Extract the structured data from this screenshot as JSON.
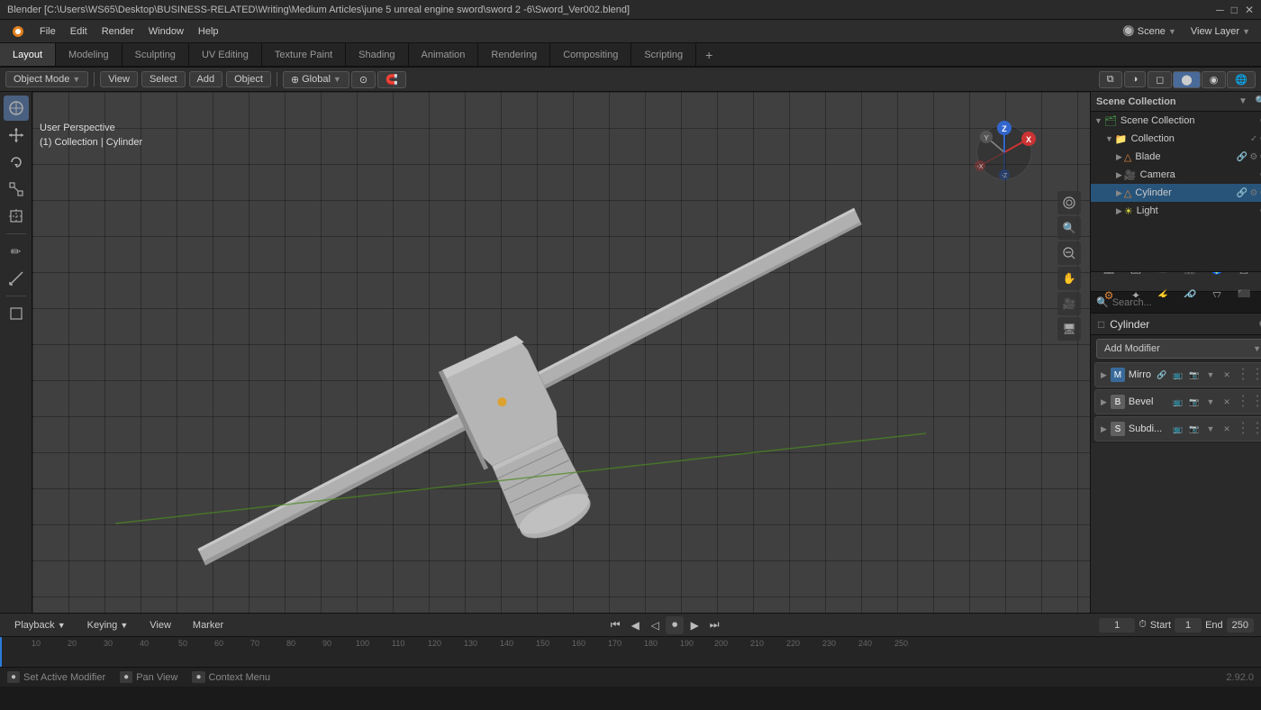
{
  "titlebar": {
    "title": "Blender [C:\\Users\\WS65\\Desktop\\BUSINESS-RELATED\\Writing\\Medium Articles\\june 5 unreal engine sword\\sword 2 -6\\Sword_Ver002.blend]",
    "controls": [
      "─",
      "□",
      "✕"
    ]
  },
  "menubar": {
    "items": [
      "Blender",
      "File",
      "Edit",
      "Render",
      "Window",
      "Help"
    ]
  },
  "workspace_tabs": {
    "tabs": [
      "Layout",
      "Modeling",
      "Sculpting",
      "UV Editing",
      "Texture Paint",
      "Shading",
      "Animation",
      "Rendering",
      "Compositing",
      "Scripting"
    ],
    "active": "Layout",
    "plus_label": "+"
  },
  "viewport_header": {
    "mode": "Object Mode",
    "view_label": "View",
    "select_label": "Select",
    "add_label": "Add",
    "object_label": "Object",
    "global_label": "Global"
  },
  "viewport_info": {
    "perspective": "User Perspective",
    "collection": "(1) Collection | Cylinder"
  },
  "outliner": {
    "title": "Scene Collection",
    "items": [
      {
        "name": "Collection",
        "level": 0,
        "type": "collection",
        "expanded": true
      },
      {
        "name": "Blade",
        "level": 1,
        "type": "mesh",
        "expanded": false
      },
      {
        "name": "Camera",
        "level": 1,
        "type": "camera",
        "expanded": false
      },
      {
        "name": "Cylinder",
        "level": 1,
        "type": "mesh",
        "expanded": false,
        "selected": true
      },
      {
        "name": "Light",
        "level": 1,
        "type": "light",
        "expanded": false
      }
    ]
  },
  "properties": {
    "search_placeholder": "Search...",
    "object_name": "Cylinder",
    "add_modifier_label": "Add Modifier",
    "modifiers": [
      {
        "name": "Mirror",
        "short": "Mirro",
        "icon_color": "blue",
        "icon": "M"
      },
      {
        "name": "Bevel",
        "short": "Bevel",
        "icon_color": "white",
        "icon": "B"
      },
      {
        "name": "Subdivision",
        "short": "Subdi...",
        "icon_color": "white",
        "icon": "S"
      }
    ]
  },
  "timeline": {
    "playback_label": "Playback",
    "keying_label": "Keying",
    "view_label": "View",
    "marker_label": "Marker",
    "current_frame": "1",
    "start_label": "Start",
    "start_frame": "1",
    "end_label": "End",
    "end_frame": "250",
    "numbers": [
      "10",
      "20",
      "30",
      "40",
      "50",
      "60",
      "70",
      "80",
      "90",
      "100",
      "110",
      "120",
      "130",
      "140",
      "150",
      "160",
      "170",
      "180",
      "190",
      "200",
      "210",
      "220",
      "230",
      "240",
      "250"
    ]
  },
  "statusbar": {
    "items": [
      {
        "key": "◉",
        "label": "Set Active Modifier"
      },
      {
        "key": "◉",
        "label": "Pan View"
      },
      {
        "key": "◉",
        "label": "Context Menu"
      }
    ],
    "version": "2.92.0"
  },
  "icons": {
    "cursor": "⊕",
    "move": "⤢",
    "rotate": "↻",
    "scale": "⤡",
    "transform": "⊞",
    "annotate": "✏",
    "measure": "📏",
    "add_cube": "⬜",
    "search": "🔍",
    "hand": "✋",
    "camera_view": "🎥",
    "render": "🖥",
    "expand": "▶",
    "collapse": "▼"
  }
}
